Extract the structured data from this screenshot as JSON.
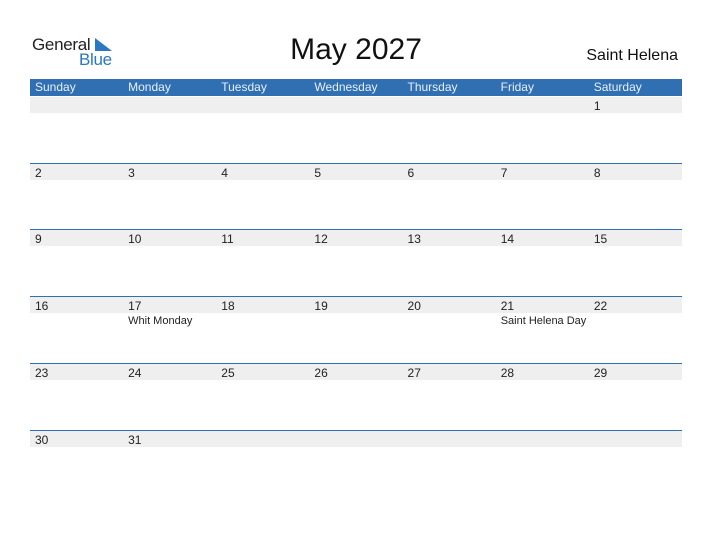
{
  "logo": {
    "text_general": "General",
    "text_blue": "Blue",
    "brand_color": "#2a77c2"
  },
  "title": "May 2027",
  "country": "Saint Helena",
  "colors": {
    "header_bg": "#2f6fb2",
    "date_strip": "#efefef"
  },
  "weekdays": [
    "Sunday",
    "Monday",
    "Tuesday",
    "Wednesday",
    "Thursday",
    "Friday",
    "Saturday"
  ],
  "weeks": [
    [
      {
        "day": ""
      },
      {
        "day": ""
      },
      {
        "day": ""
      },
      {
        "day": ""
      },
      {
        "day": ""
      },
      {
        "day": ""
      },
      {
        "day": "1"
      }
    ],
    [
      {
        "day": "2"
      },
      {
        "day": "3"
      },
      {
        "day": "4"
      },
      {
        "day": "5"
      },
      {
        "day": "6"
      },
      {
        "day": "7"
      },
      {
        "day": "8"
      }
    ],
    [
      {
        "day": "9"
      },
      {
        "day": "10"
      },
      {
        "day": "11"
      },
      {
        "day": "12"
      },
      {
        "day": "13"
      },
      {
        "day": "14"
      },
      {
        "day": "15"
      }
    ],
    [
      {
        "day": "16"
      },
      {
        "day": "17",
        "holiday": "Whit Monday"
      },
      {
        "day": "18"
      },
      {
        "day": "19"
      },
      {
        "day": "20"
      },
      {
        "day": "21",
        "holiday": "Saint Helena Day"
      },
      {
        "day": "22"
      }
    ],
    [
      {
        "day": "23"
      },
      {
        "day": "24"
      },
      {
        "day": "25"
      },
      {
        "day": "26"
      },
      {
        "day": "27"
      },
      {
        "day": "28"
      },
      {
        "day": "29"
      }
    ],
    [
      {
        "day": "30"
      },
      {
        "day": "31"
      },
      {
        "day": ""
      },
      {
        "day": ""
      },
      {
        "day": ""
      },
      {
        "day": ""
      },
      {
        "day": ""
      }
    ]
  ]
}
